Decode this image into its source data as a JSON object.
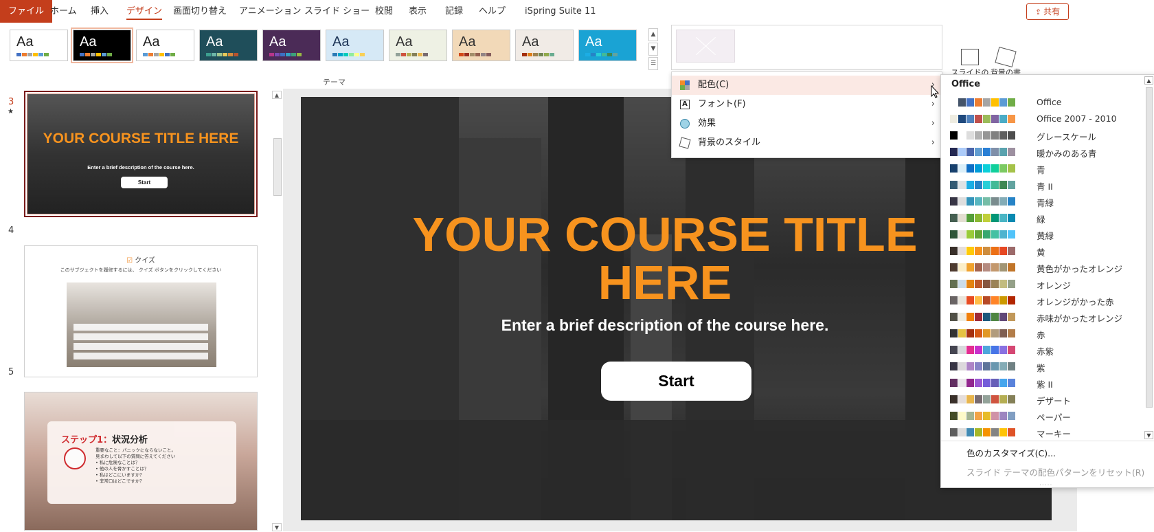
{
  "tabs": [
    {
      "label": "ファイル",
      "kind": "file"
    },
    {
      "label": "ホーム"
    },
    {
      "label": "挿入"
    },
    {
      "label": "デザイン",
      "active": true
    },
    {
      "label": "画面切り替え"
    },
    {
      "label": "アニメーション"
    },
    {
      "label": "スライド ショー"
    },
    {
      "label": "校閲"
    },
    {
      "label": "表示"
    },
    {
      "label": "記録"
    },
    {
      "label": "ヘルプ"
    },
    {
      "label": "iSpring Suite 11"
    }
  ],
  "share": {
    "label": "共有",
    "icon": "share-icon"
  },
  "ribbon": {
    "themes_group_label": "テーマ",
    "themes": [
      {
        "sample": "Aa",
        "bg": "#ffffff",
        "fg": "#222222",
        "colors": [
          "#4472c4",
          "#ed7d31",
          "#a5a5a5",
          "#ffc000",
          "#5b9bd5",
          "#70ad47"
        ]
      },
      {
        "sample": "Aa",
        "bg": "#000000",
        "fg": "#ffffff",
        "colors": [
          "#4472c4",
          "#ed7d31",
          "#a5a5a5",
          "#ffc000",
          "#5b9bd5",
          "#70ad47"
        ],
        "selected": true
      },
      {
        "sample": "Aa",
        "bg": "#ffffff",
        "fg": "#222222",
        "colors": [
          "#5b9bd5",
          "#ed7d31",
          "#a5a5a5",
          "#ffc000",
          "#4472c4",
          "#70ad47"
        ]
      },
      {
        "sample": "Aa",
        "bg": "#1f4e5a",
        "fg": "#ffffff",
        "colors": [
          "#3c9e8f",
          "#6cb6a8",
          "#a0c58d",
          "#e6c85a",
          "#d48a3c",
          "#b8532e"
        ]
      },
      {
        "sample": "Aa",
        "bg": "#4b2b57",
        "fg": "#ffffff",
        "colors": [
          "#b8358a",
          "#7a4cb5",
          "#3c6fc4",
          "#34a2c4",
          "#3ba17a",
          "#96b843"
        ]
      },
      {
        "sample": "Aa",
        "bg": "#d6e9f6",
        "fg": "#1d3557",
        "colors": [
          "#2c7bb6",
          "#00a6ca",
          "#00ccbc",
          "#90eb9d",
          "#ffff8c",
          "#f9d057"
        ]
      },
      {
        "sample": "Aa",
        "bg": "#eef1e4",
        "fg": "#333333",
        "colors": [
          "#93a299",
          "#cf543f",
          "#b5ae53",
          "#848058",
          "#e8b54d",
          "#786c71"
        ]
      },
      {
        "sample": "Aa",
        "bg": "#f2d9b8",
        "fg": "#333333",
        "colors": [
          "#d34817",
          "#9b2d1f",
          "#a28e6a",
          "#956251",
          "#918485",
          "#855d5d"
        ]
      },
      {
        "sample": "Aa",
        "bg": "#f1ebe6",
        "fg": "#333333",
        "colors": [
          "#a53010",
          "#de7e18",
          "#9f8351",
          "#728653",
          "#92aa4c",
          "#6aac91"
        ]
      },
      {
        "sample": "Aa",
        "bg": "#1aa3d4",
        "fg": "#ffffff",
        "colors": [
          "#1cade4",
          "#2683c6",
          "#27ced7",
          "#42ba97",
          "#3e8853",
          "#62a39f"
        ]
      }
    ],
    "slide_size_label": "スライドの\nサイズ",
    "bg_format_label": "背景の書\n式設定"
  },
  "slides": [
    {
      "num": "3",
      "star": "★",
      "current": true,
      "title": "YOUR COURSE TITLE HERE",
      "desc": "Enter a brief description of the course here.",
      "button": "Start"
    },
    {
      "num": "4",
      "quiz_label": "クイズ",
      "quiz_text": "このサブジェクトを履修するには、 クイズ ボタンをクリックしてください"
    },
    {
      "num": "5",
      "step_label": "ステップ1：",
      "step_title": "状況分析",
      "lines": [
        "重要なこと：パニックにならないこと。",
        "見まわして以下の質問に答えてください",
        "• 私に危険なことは？",
        "• 他の人を脅かすことは？",
        "• 私はどこにいますか？",
        "• 非常口はどこですか？"
      ]
    }
  ],
  "main_slide": {
    "title": "YOUR COURSE TITLE HERE",
    "description": "Enter a brief description of the course here.",
    "button": "Start"
  },
  "variant_menu": [
    {
      "label": "配色(C)",
      "icon": "color-scheme-icon",
      "hover": true
    },
    {
      "label": "フォント(F)",
      "icon": "font-icon"
    },
    {
      "label": "効果",
      "icon": "effects-icon"
    },
    {
      "label": "背景のスタイル",
      "icon": "background-style-icon"
    }
  ],
  "colors_menu": {
    "header": "Office",
    "schemes": [
      {
        "name": "Office",
        "colors": [
          "#ffffff",
          "#44546a",
          "#4472c4",
          "#ed7d31",
          "#a5a5a5",
          "#ffc000",
          "#5b9bd5",
          "#70ad47"
        ]
      },
      {
        "name": "Office 2007 - 2010",
        "colors": [
          "#eeece1",
          "#1f497d",
          "#4f81bd",
          "#c0504d",
          "#9bbb59",
          "#8064a2",
          "#4bacc6",
          "#f79646"
        ]
      },
      {
        "name": "グレースケール",
        "colors": [
          "#000000",
          "#ffffff",
          "#dddddd",
          "#b2b2b2",
          "#969696",
          "#808080",
          "#5f5f5f",
          "#4d4d4d"
        ]
      },
      {
        "name": "暖かみのある青",
        "colors": [
          "#242852",
          "#accbf9",
          "#4a66ac",
          "#629dd1",
          "#297fd5",
          "#7f8fa9",
          "#5aa2ae",
          "#9d90a0"
        ]
      },
      {
        "name": "青",
        "colors": [
          "#17406d",
          "#dbeff9",
          "#0f6fc6",
          "#009dd9",
          "#0bd0d9",
          "#10cf9b",
          "#7cca62",
          "#a5c249"
        ]
      },
      {
        "name": "青 II",
        "colors": [
          "#335b74",
          "#dfe3e5",
          "#1cade4",
          "#2683c6",
          "#27ced7",
          "#42ba97",
          "#3e8853",
          "#62a39f"
        ]
      },
      {
        "name": "青緑",
        "colors": [
          "#373545",
          "#dedede",
          "#3494ba",
          "#58b6c0",
          "#75bda7",
          "#7a8c8e",
          "#84acb6",
          "#2683c6"
        ]
      },
      {
        "name": "緑",
        "colors": [
          "#455f51",
          "#e3ded1",
          "#549e39",
          "#8ab833",
          "#c0cf3a",
          "#029676",
          "#4ab5c4",
          "#0989b1"
        ]
      },
      {
        "name": "黄緑",
        "colors": [
          "#2f5538",
          "#e9e5dc",
          "#99cb38",
          "#63a537",
          "#37a76f",
          "#44c1a3",
          "#4eb3cf",
          "#51c3f9"
        ]
      },
      {
        "name": "黄",
        "colors": [
          "#39302a",
          "#e5dedb",
          "#ffca08",
          "#f8931d",
          "#ce8d3e",
          "#ec7016",
          "#e64823",
          "#9c6a6a"
        ]
      },
      {
        "name": "黄色がかったオレンジ",
        "colors": [
          "#4e3b30",
          "#fbeec9",
          "#f0a22e",
          "#a5644e",
          "#b58b80",
          "#c3986d",
          "#a19574",
          "#c17529"
        ]
      },
      {
        "name": "オレンジ",
        "colors": [
          "#637052",
          "#ccddea",
          "#e48312",
          "#bd582c",
          "#865640",
          "#9b8357",
          "#c2bc80",
          "#94a088"
        ]
      },
      {
        "name": "オレンジがかった赤",
        "colors": [
          "#696464",
          "#e9e5dc",
          "#e84c22",
          "#ffbd47",
          "#b64926",
          "#ff8427",
          "#cc9900",
          "#b22600"
        ]
      },
      {
        "name": "赤味がかったオレンジ",
        "colors": [
          "#505046",
          "#eeece1",
          "#f07f09",
          "#9f2936",
          "#1b587c",
          "#4e8542",
          "#604878",
          "#c19859"
        ]
      },
      {
        "name": "赤",
        "colors": [
          "#323232",
          "#e5c243",
          "#a5300f",
          "#d55816",
          "#e19825",
          "#b19c7d",
          "#7f5f52",
          "#b27d49"
        ]
      },
      {
        "name": "赤紫",
        "colors": [
          "#454551",
          "#d8d9dc",
          "#e32d91",
          "#c830cc",
          "#4ea6dc",
          "#4775e7",
          "#8971e1",
          "#d54773"
        ]
      },
      {
        "name": "紫",
        "colors": [
          "#373545",
          "#dcd8dc",
          "#ad84c6",
          "#8784c7",
          "#5d739a",
          "#6997af",
          "#84acb6",
          "#6f8183"
        ]
      },
      {
        "name": "紫 II",
        "colors": [
          "#632e62",
          "#eae5eb",
          "#92278f",
          "#9b57d3",
          "#755dd9",
          "#665eb8",
          "#45a5ed",
          "#5982db"
        ]
      },
      {
        "name": "デザート",
        "colors": [
          "#39302a",
          "#e5dedb",
          "#e8b54d",
          "#786c71",
          "#93a299",
          "#cf543f",
          "#b5ae53",
          "#848058"
        ]
      },
      {
        "name": "ペーパー",
        "colors": [
          "#444d26",
          "#fefac9",
          "#a5b592",
          "#f3a447",
          "#e7bc29",
          "#d092a7",
          "#9c85c0",
          "#809ec2"
        ]
      },
      {
        "name": "マーキー",
        "colors": [
          "#5e5e5e",
          "#dddddd",
          "#418ab3",
          "#a6b727",
          "#f69200",
          "#838383",
          "#fec306",
          "#df5327"
        ]
      }
    ],
    "customize_label": "色のカスタマイズ(C)...",
    "reset_label": "スライド テーマの配色パターンをリセット(R)",
    "more_label": "....."
  }
}
